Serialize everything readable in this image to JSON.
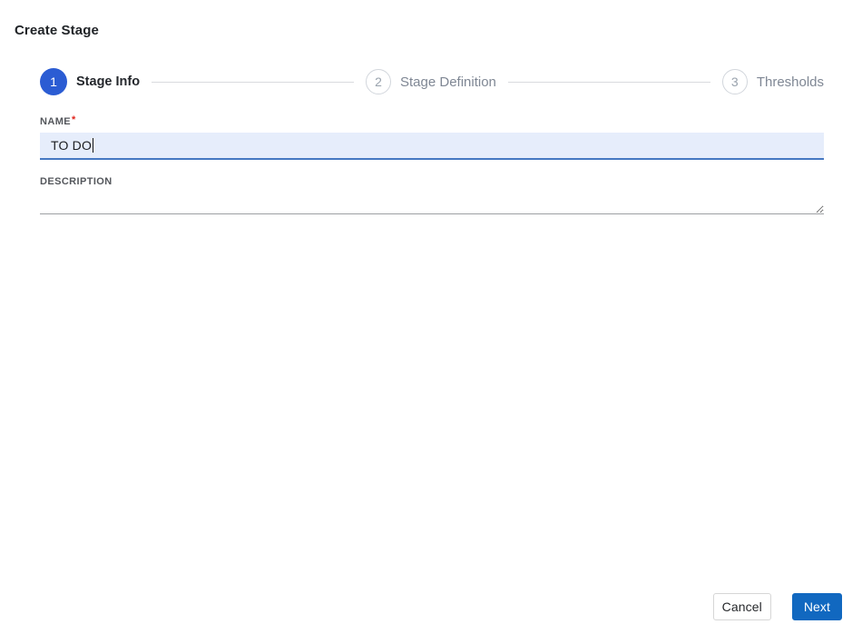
{
  "header": {
    "title": "Create Stage"
  },
  "stepper": {
    "steps": [
      {
        "number": "1",
        "label": "Stage Info",
        "state": "active"
      },
      {
        "number": "2",
        "label": "Stage Definition",
        "state": "upcoming"
      },
      {
        "number": "3",
        "label": "Thresholds",
        "state": "upcoming"
      }
    ]
  },
  "form": {
    "name": {
      "label": "NAME",
      "required_marker": "*",
      "value": "TO DO",
      "placeholder": ""
    },
    "description": {
      "label": "DESCRIPTION",
      "value": "",
      "placeholder": ""
    }
  },
  "footer": {
    "cancel_label": "Cancel",
    "next_label": "Next"
  },
  "colors": {
    "active_step_circle": "#2b5cd3",
    "inactive_step_border": "#d2d6dc",
    "inactive_step_text": "#7f8794",
    "connector_line": "#d9dbde",
    "name_input_background": "#e6edfb",
    "name_input_underline": "#4678c2",
    "description_underline": "#9da0a3",
    "required_asterisk": "#e0251d",
    "primary_button": "#1168c0",
    "cancel_border": "#d6d6d6"
  }
}
